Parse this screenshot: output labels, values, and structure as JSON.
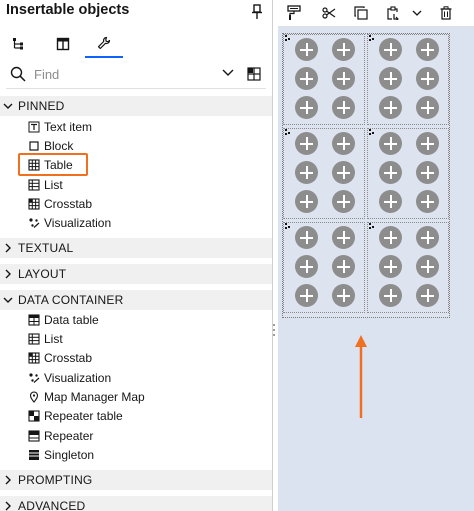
{
  "panel": {
    "title": "Insertable objects",
    "search": {
      "placeholder": "Find"
    }
  },
  "sections": {
    "pinned": "PINNED",
    "textual": "TEXTUAL",
    "layout": "LAYOUT",
    "data_container": "DATA CONTAINER",
    "prompting": "PROMPTING",
    "advanced": "ADVANCED"
  },
  "pinned_items": [
    "Text item",
    "Block",
    "Table",
    "List",
    "Crosstab",
    "Visualization"
  ],
  "data_container_items": [
    "Data table",
    "List",
    "Crosstab",
    "Visualization",
    "Map Manager Map",
    "Repeater table",
    "Repeater",
    "Singleton"
  ],
  "icons": {
    "tabs": [
      "hierarchy-icon",
      "page-layout-icon",
      "wrench-icon"
    ],
    "toolbar": [
      "paint-format-icon",
      "cut-icon",
      "copy-icon",
      "paste-icon",
      "chevron-down-icon",
      "trash-icon"
    ]
  },
  "colors": {
    "highlight": "#f07020",
    "arrow": "#f07020",
    "canvas": "#dbe3f0",
    "tab_active": "#0f62fe"
  }
}
